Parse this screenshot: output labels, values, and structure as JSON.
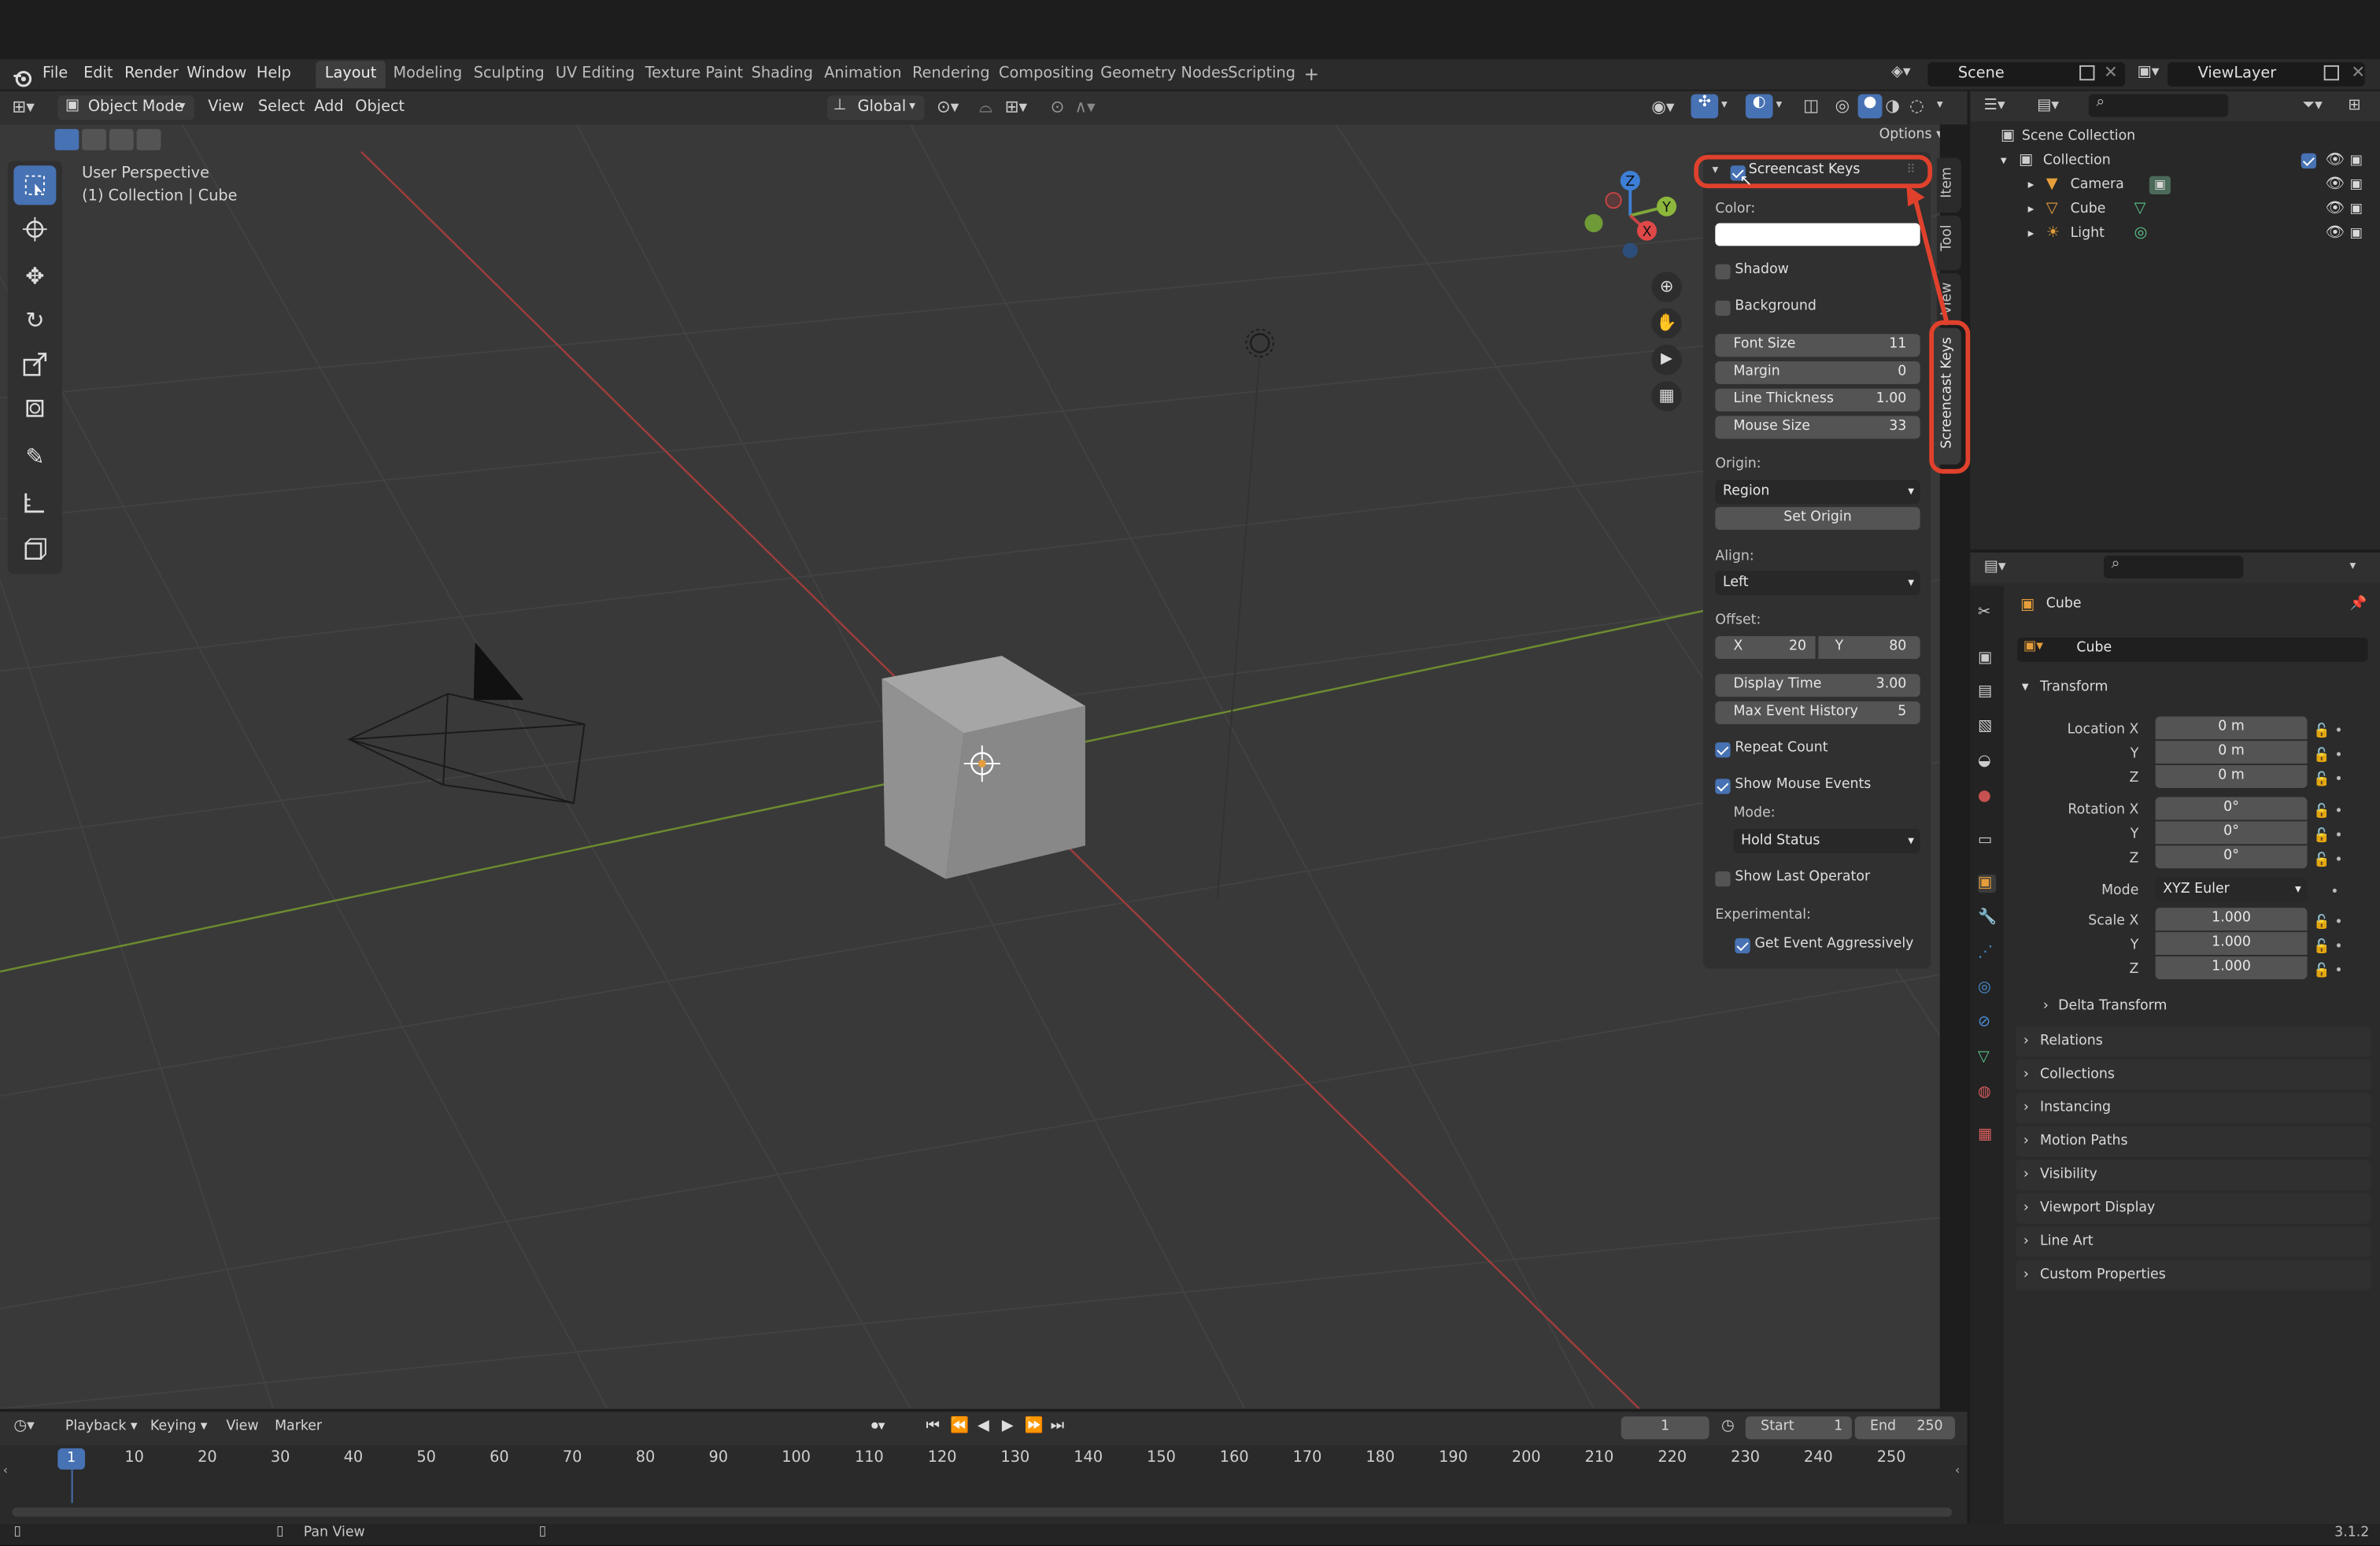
{
  "menubar": {
    "items": [
      "File",
      "Edit",
      "Render",
      "Window",
      "Help"
    ],
    "workspaces": [
      "Layout",
      "Modeling",
      "Sculpting",
      "UV Editing",
      "Texture Paint",
      "Shading",
      "Animation",
      "Rendering",
      "Compositing",
      "Geometry Nodes",
      "Scripting"
    ],
    "active_workspace": "Layout",
    "add_tab": "+",
    "scene_label": "Scene",
    "viewlayer_label": "ViewLayer"
  },
  "viewport_header": {
    "mode": "Object Mode",
    "menus": [
      "View",
      "Select",
      "Add",
      "Object"
    ],
    "orientation": "Global",
    "options": "Options"
  },
  "viewport": {
    "perspective": "User Perspective",
    "collection_info": "(1) Collection | Cube",
    "gizmo_axes": [
      "Z",
      "Y",
      "X"
    ],
    "colors": {
      "x_axis": "#b5413e",
      "y_axis": "#86a33a",
      "background": "#393939"
    }
  },
  "screencast_panel": {
    "title": "Screencast Keys",
    "enabled": true,
    "color_label": "Color:",
    "shadow_label": "Shadow",
    "background_label": "Background",
    "font_size_label": "Font Size",
    "font_size": "11",
    "margin_label": "Margin",
    "margin": "0",
    "line_thickness_label": "Line Thickness",
    "line_thickness": "1.00",
    "mouse_size_label": "Mouse Size",
    "mouse_size": "33",
    "origin_label": "Origin:",
    "origin": "Region",
    "set_origin": "Set Origin",
    "align_label": "Align:",
    "align": "Left",
    "offset_label": "Offset:",
    "offset_x_label": "X",
    "offset_x": "20",
    "offset_y_label": "Y",
    "offset_y": "80",
    "display_time_label": "Display Time",
    "display_time": "3.00",
    "max_history_label": "Max Event History",
    "max_history": "5",
    "repeat_count_label": "Repeat Count",
    "show_mouse_label": "Show Mouse Events",
    "mode_label": "Mode:",
    "mode": "Hold Status",
    "show_last_op_label": "Show Last Operator",
    "experimental_label": "Experimental:",
    "get_event_label": "Get Event Aggressively"
  },
  "side_tabs": [
    "Item",
    "Tool",
    "View",
    "Screencast Keys"
  ],
  "outliner": {
    "root": "Scene Collection",
    "collection": "Collection",
    "objects": [
      "Camera",
      "Cube",
      "Light"
    ]
  },
  "properties": {
    "object_name": "Cube",
    "data_name": "Cube",
    "transform_label": "Transform",
    "location_label": "Location X",
    "rotation_label": "Rotation X",
    "scale_label": "Scale X",
    "y_label": "Y",
    "z_label": "Z",
    "location": [
      "0 m",
      "0 m",
      "0 m"
    ],
    "rotation": [
      "0°",
      "0°",
      "0°"
    ],
    "mode_label": "Mode",
    "mode": "XYZ Euler",
    "scale": [
      "1.000",
      "1.000",
      "1.000"
    ],
    "sections": [
      "Delta Transform",
      "Relations",
      "Collections",
      "Instancing",
      "Motion Paths",
      "Visibility",
      "Viewport Display",
      "Line Art",
      "Custom Properties"
    ]
  },
  "timeline": {
    "menus": [
      "Playback",
      "Keying",
      "View",
      "Marker"
    ],
    "current_frame": "1",
    "start_label": "Start",
    "start": "1",
    "end_label": "End",
    "end": "250",
    "ticks": [
      "10",
      "20",
      "30",
      "40",
      "50",
      "60",
      "70",
      "80",
      "90",
      "100",
      "110",
      "120",
      "130",
      "140",
      "150",
      "160",
      "170",
      "180",
      "190",
      "200",
      "210",
      "220",
      "230",
      "240",
      "250"
    ],
    "playhead": "1"
  },
  "statusbar": {
    "hint": "Pan View",
    "version": "3.1.2"
  }
}
